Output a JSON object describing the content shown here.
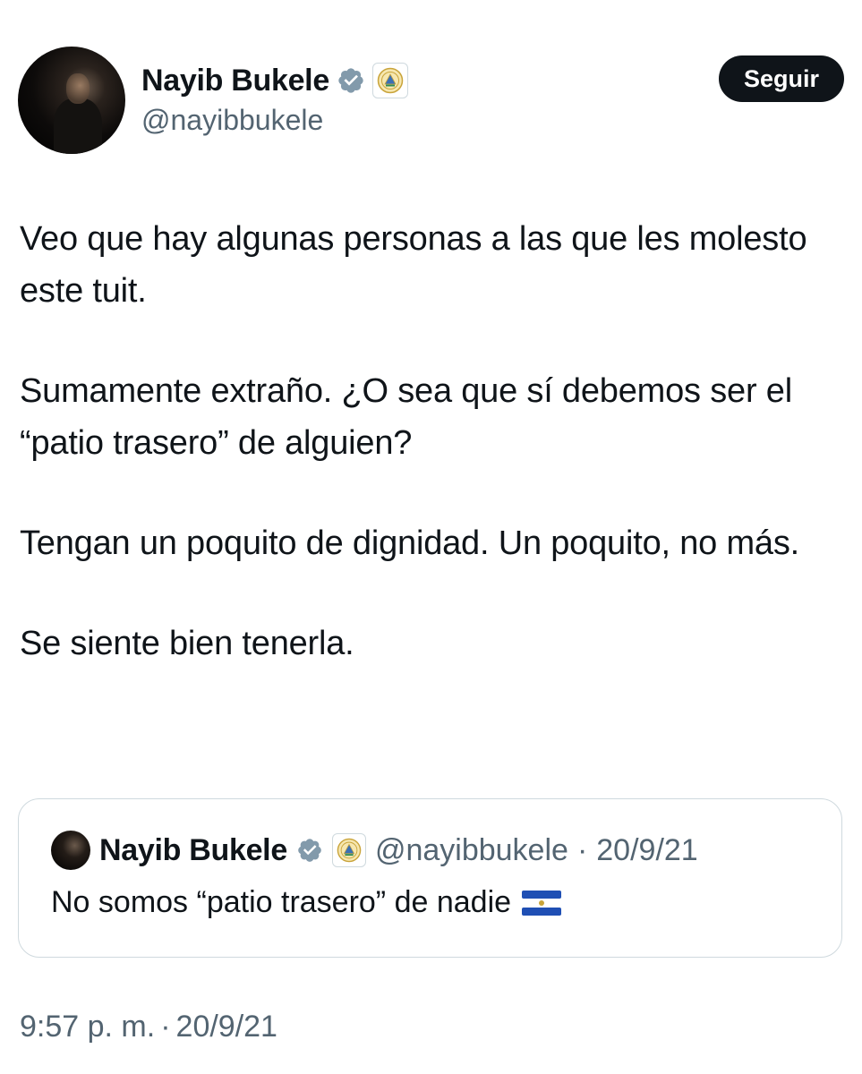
{
  "tweet": {
    "author": {
      "display_name": "Nayib Bukele",
      "handle": "@nayibbukele",
      "verified_icon": "verified-badge-icon",
      "affiliation_icon": "el-salvador-coat-of-arms-icon"
    },
    "follow_label": "Seguir",
    "paragraphs": [
      "Veo que hay algunas personas a las que les molesto este tuit.",
      "Sumamente extraño. ¿O sea que sí debemos ser el “patio trasero” de alguien?",
      "Tengan un poquito de dignidad. Un poquito, no más.",
      "Se siente bien tenerla."
    ],
    "quoted": {
      "display_name": "Nayib Bukele",
      "handle": "@nayibbukele",
      "separator": "·",
      "date": "20/9/21",
      "text": "No somos “patio trasero” de nadie",
      "flag_icon": "el-salvador-flag-icon"
    },
    "timestamp": {
      "time": "9:57 p. m.",
      "separator": "·",
      "date": "20/9/21"
    }
  },
  "colors": {
    "text_primary": "#0f1419",
    "text_secondary": "#536471",
    "verified": "#829aab",
    "border": "#cfd9de",
    "follow_bg": "#0f1419"
  }
}
